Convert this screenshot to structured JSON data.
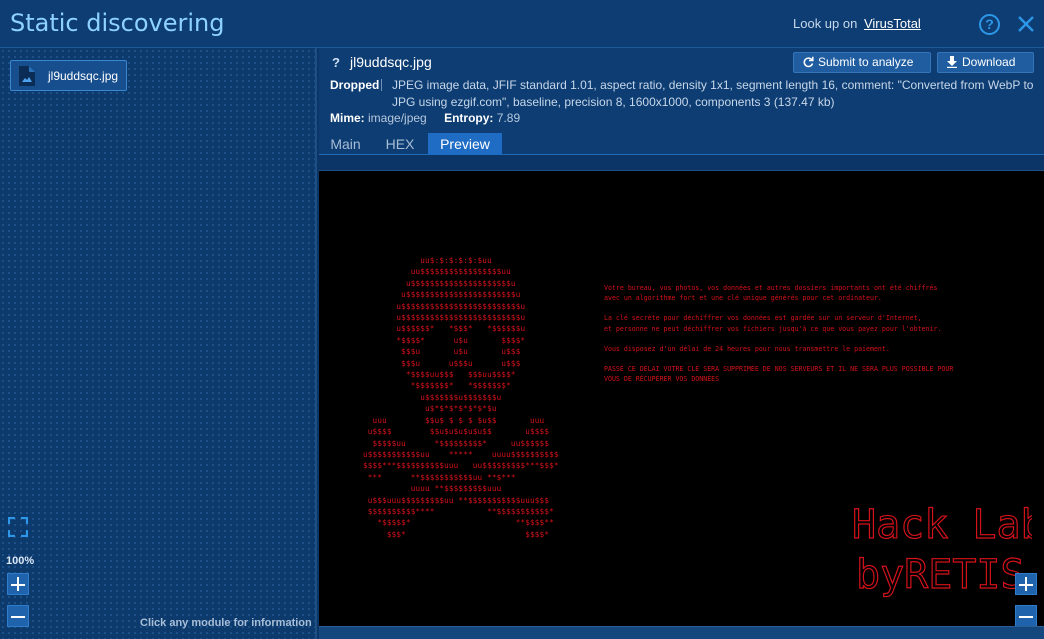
{
  "header": {
    "title": "Static discovering",
    "lookup_prefix": "Look up on",
    "lookup_link": "VirusTotal",
    "help_icon": "help-circle-icon",
    "close_icon": "close-icon"
  },
  "sidebar": {
    "file_chip_label": "jl9uddsqc.jpg",
    "file_icon": "image-file-icon",
    "zoom_level": "100%",
    "hint": "Click any module for information"
  },
  "file": {
    "unknown_mark": "?",
    "name": "jl9uddsqc.jpg",
    "submit_label": "Submit to analyze",
    "download_label": "Download",
    "dropped_label": "Dropped",
    "description": "JPEG image data, JFIF standard 1.01, aspect ratio, density 1x1, segment length 16, comment: \"Converted from WebP to JPG using ezgif.com\", baseline, precision 8, 1600x1000, components 3 (137.47 kb)",
    "mime_label": "Mime:",
    "mime_value": "image/jpeg",
    "entropy_label": "Entropy:",
    "entropy_value": "7.89"
  },
  "tabs": [
    {
      "label": "Main",
      "active": false
    },
    {
      "label": "HEX",
      "active": false
    },
    {
      "label": "Preview",
      "active": true
    }
  ],
  "preview": {
    "skull_ascii": "            uu$:$:$:$:$:$uu\n          uu$$$$$$$$$$$$$$$$$uu\n         u$$$$$$$$$$$$$$$$$$$$$u\n        u$$$$$$$$$$$$$$$$$$$$$$$u\n       u$$$$$$$$$$$$$$$$$$$$$$$$$u\n       u$$$$$$$$$$$$$$$$$$$$$$$$$u\n       u$$$$$$*   *$$$*   *$$$$$$u\n       *$$$$*      u$u       $$$$*\n        $$$u       u$u       u$$$\n        $$$u      u$$$u      u$$$\n         *$$$$uu$$$   $$$uu$$$$*\n          *$$$$$$$*   *$$$$$$$*\n            u$$$$$$$u$$$$$$$u\n             u$*$*$*$*$*$*$u\n  uuu        $$u$ $ $ $ $u$$       uuu\n u$$$$        $$u$u$u$u$u$$       u$$$$\n  $$$$$uu      *$$$$$$$$$*     uu$$$$$$\nu$$$$$$$$$$$uu    *****    uuuu$$$$$$$$$$\n$$$$***$$$$$$$$$$uuu   uu$$$$$$$$$***$$$*\n ***      **$$$$$$$$$$$uu **$***\n          uuuu **$$$$$$$$$uuu\n u$$$uuu$$$$$$$$$uu **$$$$$$$$$$$uuu$$$\n $$$$$$$$$$****           **$$$$$$$$$$$*\n   *$$$$$*                      **$$$$**\n     $$$*                         $$$$*",
    "ransom_paragraphs": [
      "Votre bureau, vos photos, vos données et autres dossiers importants ont été chiffrés\navec un algorithme fort et une clé unique générés pour cet ordinateur.",
      "La clé secrète pour déchiffrer vos données est gardée sur un serveur d'Internet,\net personne ne peut déchiffrer vos fichiers jusqu'à ce que vous payez pour l'obtenir.",
      "Vous disposez d'un délai de 24 heures pour nous transmettre le paiement.",
      "PASSÉ CE DÉLAI VOTRE CLÉ SERA SUPPRIMÉE DE NOS SERVEURS ET IL NE SERA PLUS POSSIBLE POUR\nVOUS DE RÉCUPÉRER VOS DONNÉES"
    ],
    "logo_line1": "Hack Lab",
    "logo_line2": "byRETIS"
  },
  "colors": {
    "accent": "#2e97e8",
    "ransom_red": "#d4121a",
    "active_tab": "#1f6cc4"
  }
}
